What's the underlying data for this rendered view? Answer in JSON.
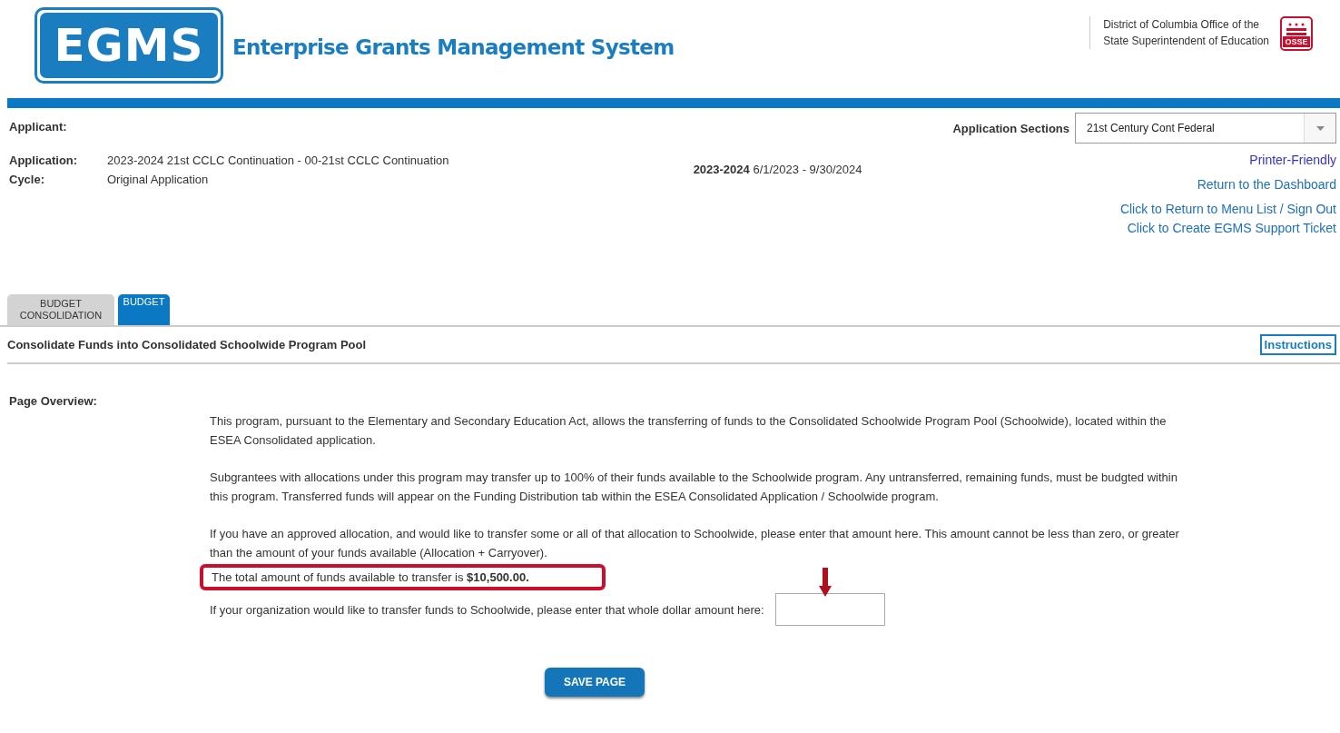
{
  "header": {
    "logo": "EGMS",
    "title": "Enterprise Grants Management System",
    "agency": [
      "District of Columbia Office of the",
      "State Superintendent of Education"
    ],
    "agency_logo": "OSSE"
  },
  "info": {
    "applicant_label": "Applicant:",
    "application_label": "Application:",
    "application_value": "2023-2024 21st CCLC Continuation - 00-21st CCLC Continuation",
    "cycle_label": "Cycle:",
    "cycle_value": "Original Application",
    "period_year": "2023-2024",
    "period_dates": "6/1/2023 - 9/30/2024",
    "sections_label": "Application Sections",
    "sections_value": "21st Century Cont Federal"
  },
  "links": [
    {
      "label": "Printer-Friendly",
      "kind": "print"
    },
    {
      "label": "Return to the Dashboard",
      "kind": "nav"
    },
    {
      "label": "Click to Return to Menu List / Sign Out",
      "kind": "nav"
    },
    {
      "label": "Click to Create EGMS Support Ticket",
      "kind": "nav"
    }
  ],
  "tabs": [
    {
      "label": "BUDGET CONSOLIDATION",
      "selected": false
    },
    {
      "label": "BUDGET",
      "selected": true
    }
  ],
  "section_title": "Consolidate Funds into Consolidated Schoolwide Program Pool",
  "instructions_button": "Instructions",
  "overview_label": "Page Overview:",
  "paragraphs": [
    "This program, pursuant to the Elementary and Secondary Education Act, allows the transferring of funds to the Consolidated Schoolwide Program Pool (Schoolwide), located within the ESEA Consolidated application.",
    "Subgrantees with allocations under this program may transfer up to 100% of their funds available to the Schoolwide program. Any untransferred, remaining funds, must be budgted within this program. Transferred funds will appear on the Funding Distribution tab within the ESEA Consolidated Application / Schoolwide program.",
    "If you have an approved allocation, and would like to transfer some or all of that allocation to Schoolwide, please enter that amount here. This amount cannot be less than zero, or greater than the amount of your funds available (Allocation + Carryover)."
  ],
  "total_text": "The total amount of funds available to transfer is **$10,500.00.**",
  "total_highlighted": true,
  "transfer_label": "If your organization would like to transfer funds to Schoolwide, please enter that whole dollar amount here:",
  "save_button": "SAVE PAGE"
}
